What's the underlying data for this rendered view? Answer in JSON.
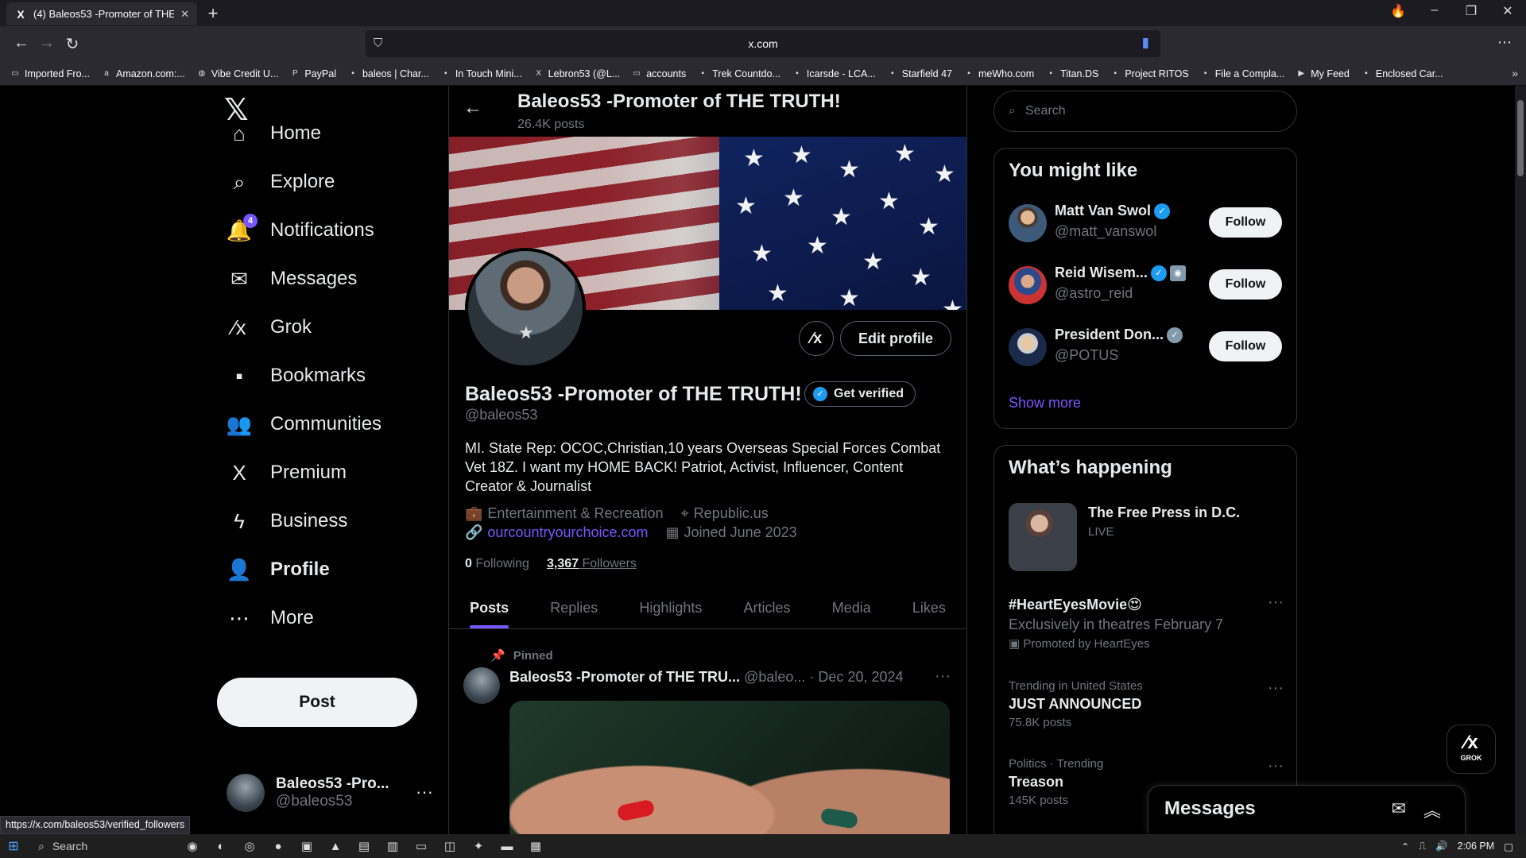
{
  "browser": {
    "tab_title": "(4) Baleos53 -Promoter of THE",
    "tab_favicon": "X",
    "url": "x.com",
    "bookmarks": [
      {
        "label": "Imported Fro...",
        "icon": "folder-icon"
      },
      {
        "label": "Amazon.com:...",
        "icon": "amazon-icon"
      },
      {
        "label": "Vibe Credit U...",
        "icon": "vibe-icon"
      },
      {
        "label": "PayPal",
        "icon": "paypal-icon"
      },
      {
        "label": "baleos | Char...",
        "icon": "bookmark-icon"
      },
      {
        "label": "In Touch Mini...",
        "icon": "bookmark-icon"
      },
      {
        "label": "Lebron53 (@L...",
        "icon": "x-icon"
      },
      {
        "label": "accounts",
        "icon": "folder-icon"
      },
      {
        "label": "Trek Countdo...",
        "icon": "bookmark-icon"
      },
      {
        "label": "Icarsde - LCA...",
        "icon": "bookmark-icon"
      },
      {
        "label": "Starfield 47",
        "icon": "bookmark-icon"
      },
      {
        "label": "meWho.com",
        "icon": "bookmark-icon"
      },
      {
        "label": "Titan.DS",
        "icon": "bookmark-icon"
      },
      {
        "label": "Project RITOS",
        "icon": "bookmark-icon"
      },
      {
        "label": "File a Compla...",
        "icon": "bookmark-icon"
      },
      {
        "label": "My Feed",
        "icon": "play-icon"
      },
      {
        "label": "Enclosed Car...",
        "icon": "bookmark-icon"
      }
    ],
    "status_url": "https://x.com/baleos53/verified_followers"
  },
  "nav": {
    "items": [
      {
        "label": "Home",
        "icon": "home-icon"
      },
      {
        "label": "Explore",
        "icon": "search-icon"
      },
      {
        "label": "Notifications",
        "icon": "bell-icon",
        "badge": "4"
      },
      {
        "label": "Messages",
        "icon": "envelope-icon"
      },
      {
        "label": "Grok",
        "icon": "grok-icon"
      },
      {
        "label": "Bookmarks",
        "icon": "bookmark-icon"
      },
      {
        "label": "Communities",
        "icon": "people-icon"
      },
      {
        "label": "Premium",
        "icon": "x-icon"
      },
      {
        "label": "Business",
        "icon": "lightning-icon"
      },
      {
        "label": "Profile",
        "icon": "person-icon"
      },
      {
        "label": "More",
        "icon": "more-circle-icon"
      }
    ],
    "post_label": "Post",
    "account": {
      "name": "Baleos53 -Pro...",
      "handle": "@baleos53"
    }
  },
  "profile": {
    "header_name": "Baleos53 -Promoter of THE TRUTH!",
    "post_count": "26.4K posts",
    "name": "Baleos53 -Promoter of THE TRUTH!",
    "get_verified_label": "Get verified",
    "handle": "@baleos53",
    "edit_label": "Edit profile",
    "bio": "MI. State Rep: OCOC,Christian,10 years Overseas Special Forces Combat Vet 18Z. I want my HOME BACK! Patriot, Activist, Influencer, Content Creator & Journalist",
    "category": "Entertainment & Recreation",
    "location": "Republic.us",
    "website": "ourcountryourchoice.com",
    "joined": "Joined June 2023",
    "following_count": "0",
    "following_label": "Following",
    "followers_count": "3,367",
    "followers_label": "Followers",
    "tabs": [
      "Posts",
      "Replies",
      "Highlights",
      "Articles",
      "Media",
      "Likes"
    ],
    "active_tab": "Posts"
  },
  "pinned_post": {
    "pinned_label": "Pinned",
    "author": "Baleos53 -Promoter of THE TRU...",
    "handle": "@baleo...",
    "date": "· Dec 20, 2024"
  },
  "sidebar": {
    "search_placeholder": "Search",
    "you_might_like": {
      "title": "You might like",
      "users": [
        {
          "name": "Matt Van Swol",
          "handle": "@matt_vanswol",
          "follow": "Follow"
        },
        {
          "name": "Reid Wisem...",
          "handle": "@astro_reid",
          "follow": "Follow"
        },
        {
          "name": "President Don...",
          "handle": "@POTUS",
          "follow": "Follow"
        }
      ],
      "show_more": "Show more"
    },
    "whats_happening": {
      "title": "What’s happening",
      "live": {
        "title": "The Free Press in D.C.",
        "status": "LIVE"
      },
      "trends": [
        {
          "context": "",
          "title": "#HeartEyesMovie😍",
          "desc": "Exclusively in theatres February 7",
          "promo": "Promoted by HeartEyes"
        },
        {
          "context": "Trending in United States",
          "title": "JUST ANNOUNCED",
          "desc": "75.8K posts"
        },
        {
          "context": "Politics · Trending",
          "title": "Treason",
          "desc": "145K posts"
        }
      ]
    }
  },
  "grok_fab_label": "GROK",
  "messages_drawer_title": "Messages",
  "taskbar": {
    "search": "Search",
    "time": "2:06 PM"
  },
  "colors": {
    "accent": "#7856ff",
    "verified": "#1d9bf0",
    "bg": "#000000"
  }
}
